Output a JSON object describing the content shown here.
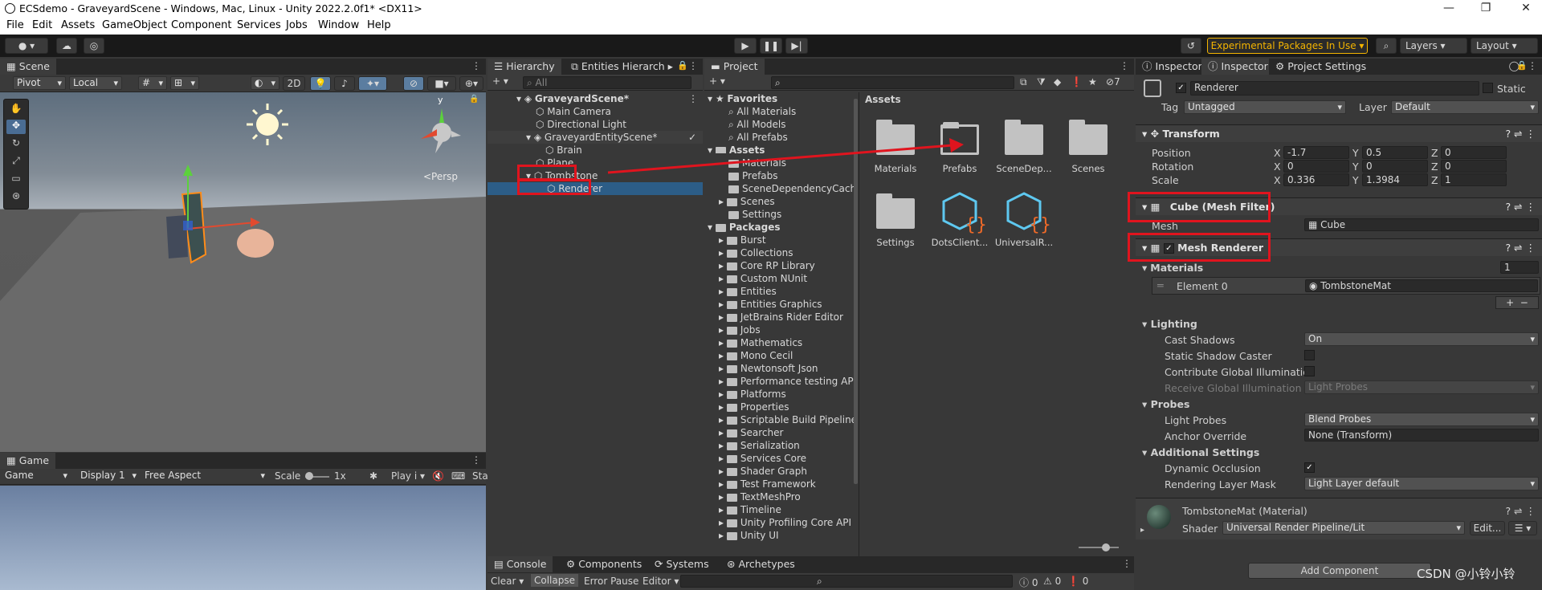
{
  "window": {
    "title": "ECSdemo - GraveyardScene - Windows, Mac, Linux - Unity 2022.2.0f1* <DX11>"
  },
  "menu": [
    "File",
    "Edit",
    "Assets",
    "GameObject",
    "Component",
    "Services",
    "Jobs",
    "Window",
    "Help"
  ],
  "toolbar": {
    "experimental": "Experimental Packages In Use",
    "layers": "Layers",
    "layout": "Layout"
  },
  "scene": {
    "tab": "Scene",
    "pivot": "Pivot",
    "local": "Local",
    "mode2d": "2D",
    "persp": "<Persp"
  },
  "game": {
    "tab": "Game",
    "view": "Game",
    "display": "Display 1",
    "aspect": "Free Aspect",
    "scale_label": "Scale",
    "scale_value": "1x",
    "play": "Play i",
    "stats": "Sta"
  },
  "hierarchy": {
    "tabs": [
      "Hierarchy",
      "Entities Hierarch"
    ],
    "search_placeholder": "All",
    "items": [
      "GraveyardScene*",
      "Main Camera",
      "Directional Light",
      "GraveyardEntityScene*",
      "Brain",
      "Plane",
      "Tombstone",
      "Renderer"
    ]
  },
  "project": {
    "tab": "Project",
    "favorites_label": "Favorites",
    "favorites": [
      "All Materials",
      "All Models",
      "All Prefabs"
    ],
    "assets_label": "Assets",
    "asset_folders": [
      "Materials",
      "Prefabs",
      "SceneDependencyCach",
      "Scenes",
      "Settings"
    ],
    "packages_label": "Packages",
    "packages": [
      "Burst",
      "Collections",
      "Core RP Library",
      "Custom NUnit",
      "Entities",
      "Entities Graphics",
      "JetBrains Rider Editor",
      "Jobs",
      "Mathematics",
      "Mono Cecil",
      "Newtonsoft Json",
      "Performance testing AP",
      "Platforms",
      "Properties",
      "Scriptable Build Pipeline",
      "Searcher",
      "Serialization",
      "Services Core",
      "Shader Graph",
      "Test Framework",
      "TextMeshPro",
      "Timeline",
      "Unity Profiling Core API",
      "Unity UI"
    ],
    "breadcrumb": "Assets",
    "grid": [
      "Materials",
      "Prefabs",
      "SceneDep...",
      "Scenes",
      "Settings",
      "DotsClient...",
      "UniversalR..."
    ],
    "hidden_count": "7"
  },
  "console": {
    "tabs": [
      "Console",
      "Components",
      "Systems",
      "Archetypes"
    ],
    "clear": "Clear",
    "collapse": "Collapse",
    "error_pause": "Error Pause",
    "editor": "Editor",
    "counts": [
      "0",
      "0",
      "0"
    ]
  },
  "inspector": {
    "tabs": [
      "Inspector",
      "Inspector",
      "Project Settings"
    ],
    "object_name": "Renderer",
    "static": "Static",
    "tag_label": "Tag",
    "tag": "Untagged",
    "layer_label": "Layer",
    "layer": "Default",
    "transform": {
      "title": "Transform",
      "position_label": "Position",
      "rotation_label": "Rotation",
      "scale_label": "Scale",
      "position": [
        "-1.7",
        "0.5",
        "0"
      ],
      "rotation": [
        "0",
        "0",
        "0"
      ],
      "scale": [
        "0.336",
        "1.3984",
        "1"
      ],
      "axes": [
        "X",
        "Y",
        "Z"
      ]
    },
    "mesh_filter": {
      "title": "Cube (Mesh Filter)",
      "mesh_label": "Mesh",
      "mesh": "Cube"
    },
    "mesh_renderer": {
      "title": "Mesh Renderer",
      "materials_label": "Materials",
      "materials_count": "1",
      "element0_label": "Element 0",
      "element0": "TombstoneMat",
      "lighting_label": "Lighting",
      "cast_shadows_label": "Cast Shadows",
      "cast_shadows": "On",
      "static_shadow_label": "Static Shadow Caster",
      "contribute_gi_label": "Contribute Global Illumination",
      "receive_gi_label": "Receive Global Illumination",
      "receive_gi": "Light Probes",
      "probes_label": "Probes",
      "light_probes_label": "Light Probes",
      "light_probes": "Blend Probes",
      "anchor_label": "Anchor Override",
      "anchor": "None (Transform)",
      "additional_label": "Additional Settings",
      "dynamic_occlusion_label": "Dynamic Occlusion",
      "rendering_layer_label": "Rendering Layer Mask",
      "rendering_layer": "Light Layer default"
    },
    "material": {
      "title": "TombstoneMat (Material)",
      "shader_label": "Shader",
      "shader": "Universal Render Pipeline/Lit",
      "edit": "Edit..."
    },
    "add_component": "Add Component"
  },
  "watermark": "CSDN @小铃小铃",
  "colors": {
    "selection": "#2c5d87",
    "annotation": "#e0141e",
    "experimental": "#f4b400"
  }
}
